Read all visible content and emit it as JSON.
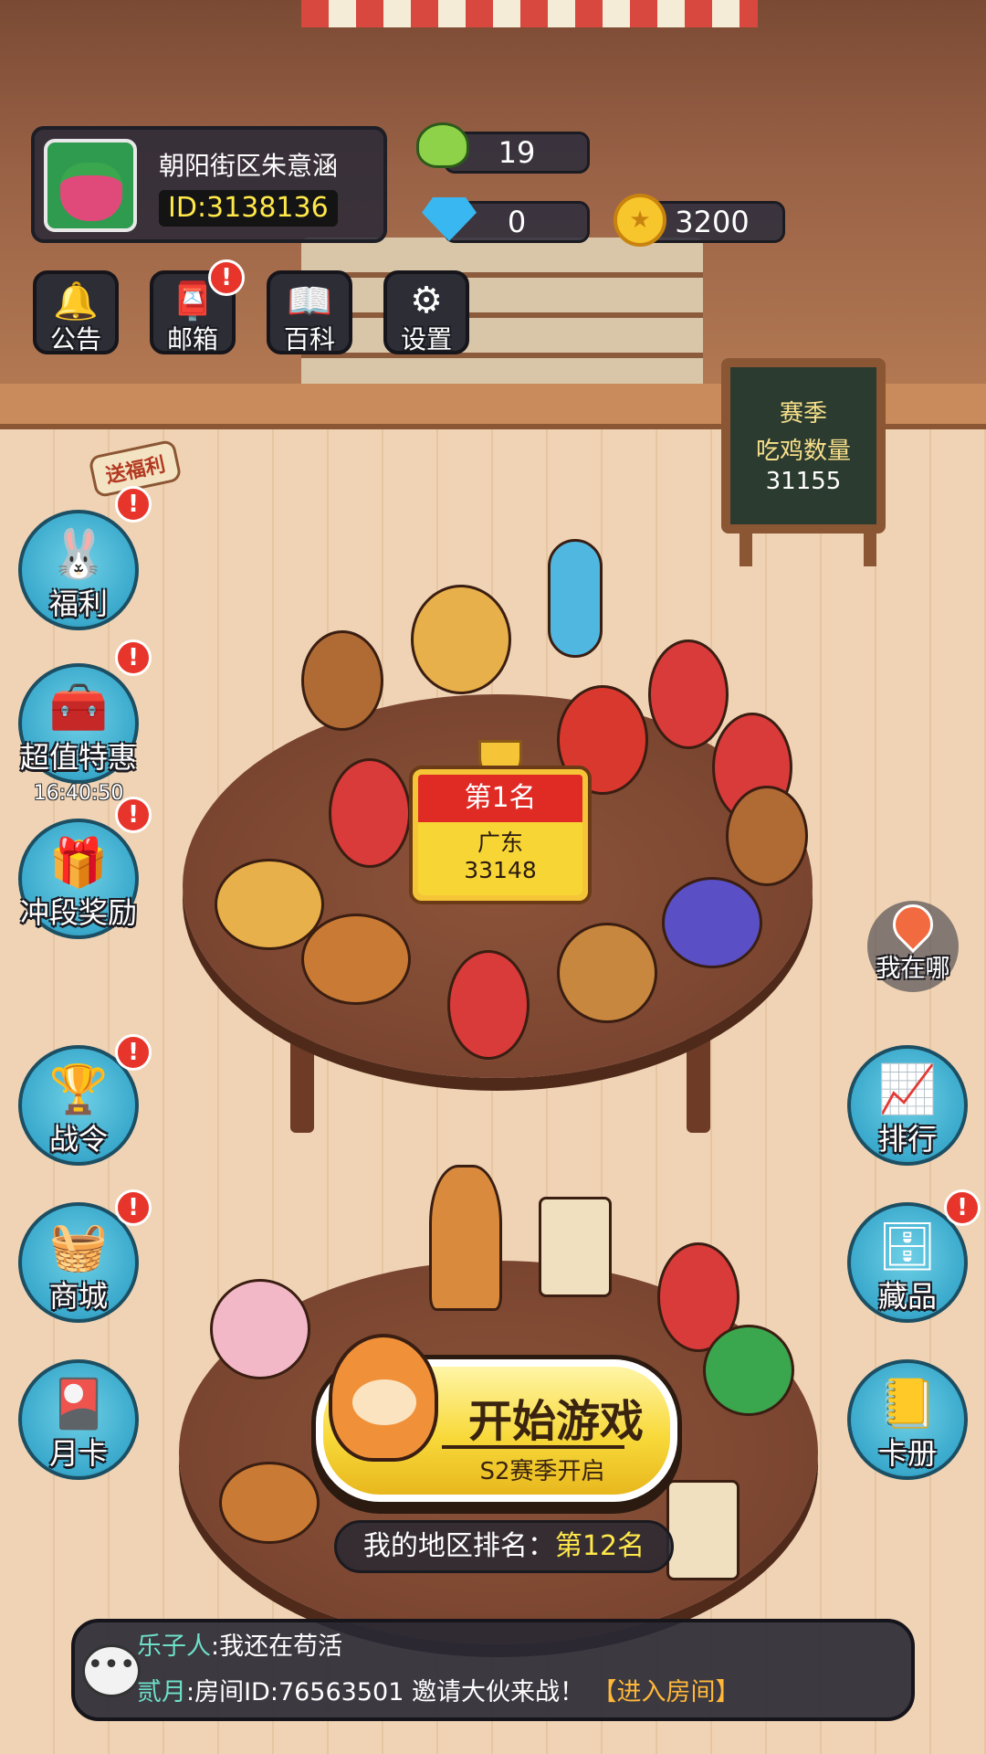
{
  "profile": {
    "name": "朝阳街区朱意涵",
    "id": "ID:3138136"
  },
  "currency": {
    "frog": "19",
    "diamond": "0",
    "coin": "3200"
  },
  "top_menu": [
    {
      "label": "公告"
    },
    {
      "label": "邮箱"
    },
    {
      "label": "百科"
    },
    {
      "label": "设置"
    }
  ],
  "board": {
    "line1": "赛季",
    "line2": "吃鸡数量",
    "value": "31155"
  },
  "gift_tag": "送福利",
  "left_menu": {
    "welfare": "福利",
    "deal": "超值特惠",
    "deal_timer": "16:40:50",
    "rank_reward": "冲段奖励",
    "battle_pass": "战令",
    "shop": "商城",
    "monthly_card": "月卡"
  },
  "right_menu": {
    "where": "我在哪",
    "ranking": "排行",
    "collection": "藏品",
    "album": "卡册"
  },
  "plaque": {
    "rank": "第1名",
    "region": "广东",
    "score": "33148"
  },
  "start": {
    "title": "开始游戏",
    "subtitle": "S2赛季开启"
  },
  "region_rank": {
    "label": "我的地区排名：",
    "value": "第12名"
  },
  "chat": [
    {
      "user": "乐子人",
      "message": ":我还在苟活",
      "link": ""
    },
    {
      "user": "贰月",
      "message": ":房间ID:76563501 邀请大伙来战！",
      "link": "【进入房间】"
    }
  ],
  "badge_text": "!",
  "colors": {
    "accent": "#f8d93a",
    "badge": "#e8352b",
    "side_button": "#3aa9cc",
    "chat_user": "#6ee0c8"
  }
}
